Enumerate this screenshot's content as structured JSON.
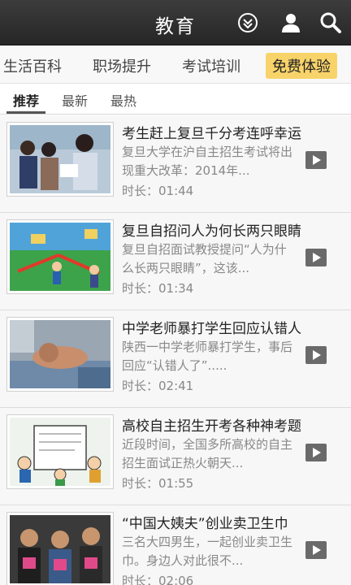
{
  "header": {
    "title": "教育",
    "icons": [
      "download-icon",
      "user-icon",
      "search-icon"
    ]
  },
  "categories": [
    "生活百科",
    "职场提升",
    "考试培训",
    "免费体验"
  ],
  "active_category": "免费体验",
  "subtabs": [
    "推荐",
    "最新",
    "最热"
  ],
  "active_subtab": "推荐",
  "items": [
    {
      "title": "考生赶上复旦千分考连呼幸运",
      "desc": "复旦大学在沪自主招生考试将出现重大改革：2014年...",
      "duration": "时长：01:44"
    },
    {
      "title": "复旦自招问人为何长两只眼睛",
      "desc": "复旦自招面试教授提问“人为什么长两只眼睛”，这该...",
      "duration": "时长：01:34"
    },
    {
      "title": "中学老师暴打学生回应认错人",
      "desc": "陕西一中学老师暴打学生，事后回应“认错人了”.....",
      "duration": "时长：02:41"
    },
    {
      "title": "高校自主招生开考各种神考题",
      "desc": "近段时间，全国多所高校的自主招生面试正热火朝天...",
      "duration": "时长：01:55"
    },
    {
      "title": "“中国大姨夫”创业卖卫生巾",
      "desc": "三名大四男生，一起创业卖卫生巾。身边人对此很不...",
      "duration": "时长：02:06"
    }
  ]
}
